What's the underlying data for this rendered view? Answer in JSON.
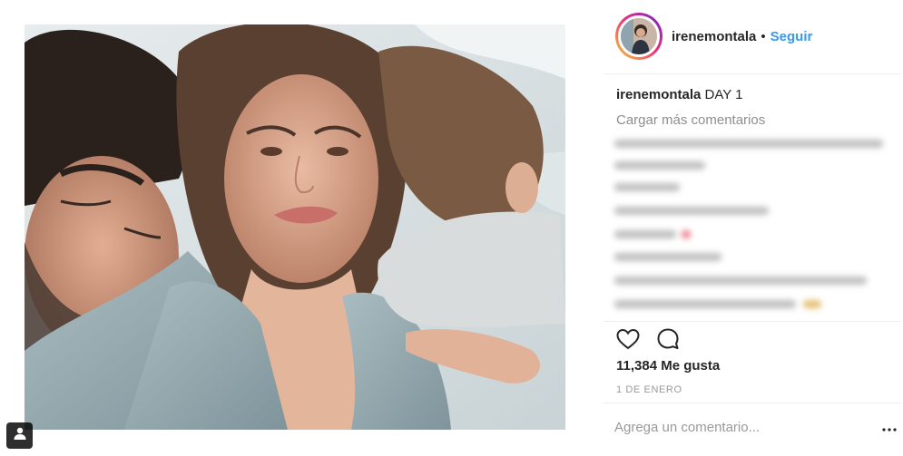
{
  "post": {
    "image_alt": "",
    "tag_icon": "person-tag-icon"
  },
  "header": {
    "username": "irenemontala",
    "separator": "•",
    "follow_label": "Seguir"
  },
  "caption": {
    "username": "irenemontala",
    "text": "DAY 1"
  },
  "comments": {
    "load_more_label": "Cargar más comentarios",
    "blurred": true
  },
  "actions": {
    "like_icon": "heart-icon",
    "comment_icon": "comment-bubble-icon"
  },
  "likes_text": "11,384 Me gusta",
  "date_text": "1 DE ENERO",
  "add_comment": {
    "placeholder": "Agrega un comentario..."
  },
  "colors": {
    "follow": "#3897f0",
    "text": "#262626",
    "muted": "#999999",
    "divider": "#efefef"
  }
}
